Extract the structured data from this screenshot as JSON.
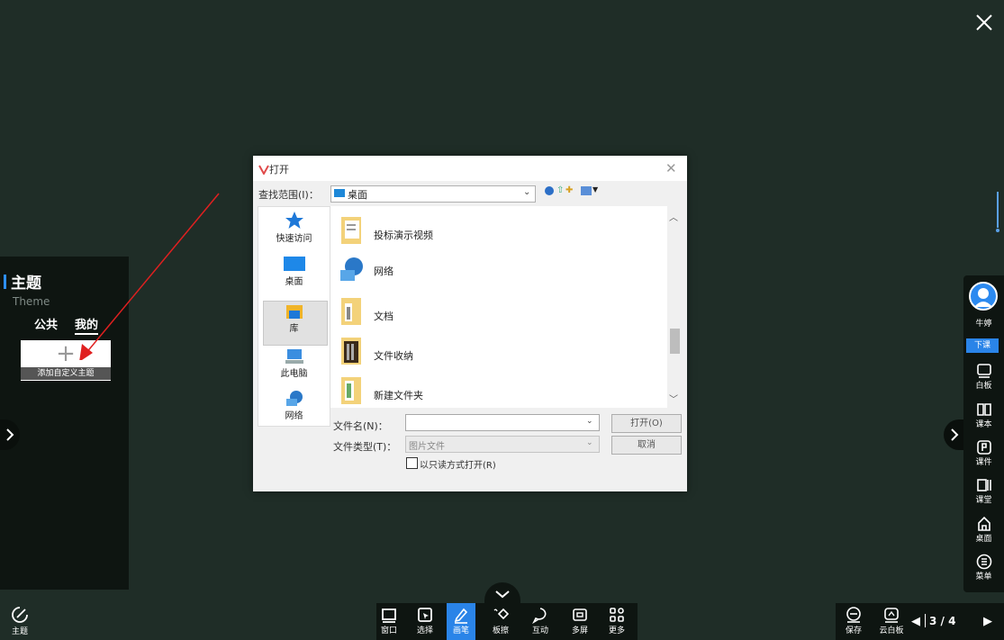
{
  "window": {
    "close_label": "✕"
  },
  "theme_panel": {
    "title": "主题",
    "subtitle": "Theme",
    "tabs": [
      {
        "label": "公共"
      },
      {
        "label": "我的"
      }
    ],
    "add_custom_label": "添加自定义主题",
    "add_plus": "+"
  },
  "dialog": {
    "title": "打开",
    "close": "✕",
    "look_in_label": "查找范围(I)：",
    "look_in_value": "桌面",
    "places": [
      {
        "label": "快速访问",
        "icon": "star-icon"
      },
      {
        "label": "桌面",
        "icon": "desktop-icon"
      },
      {
        "label": "库",
        "icon": "library-icon"
      },
      {
        "label": "此电脑",
        "icon": "computer-icon"
      },
      {
        "label": "网络",
        "icon": "network-icon"
      }
    ],
    "files": [
      {
        "name": "投标演示视频",
        "icon": "folder-icon"
      },
      {
        "name": "网络",
        "icon": "network-icon"
      },
      {
        "name": "文档",
        "icon": "folder-icon"
      },
      {
        "name": "文件收纳",
        "icon": "folder-icon"
      },
      {
        "name": "新建文件夹",
        "icon": "folder-icon"
      }
    ],
    "filename_label": "文件名(N)：",
    "filename_value": "",
    "filetype_label": "文件类型(T)：",
    "filetype_value": "图片文件",
    "readonly_label": "以只读方式打开(R)",
    "open_button": "打开(O)",
    "cancel_button": "取消"
  },
  "right_sidebar": {
    "user_name": "牛婷",
    "end_class": "下课",
    "tools": [
      {
        "label": "白板",
        "icon": "whiteboard-icon"
      },
      {
        "label": "课本",
        "icon": "book-icon"
      },
      {
        "label": "课件",
        "icon": "courseware-icon"
      },
      {
        "label": "课堂",
        "icon": "classroom-icon"
      },
      {
        "label": "桌面",
        "icon": "desktop-home-icon"
      },
      {
        "label": "菜单",
        "icon": "menu-icon"
      }
    ]
  },
  "bottom_bar": {
    "theme_label": "主题",
    "tools": [
      {
        "label": "窗口",
        "icon": "window-icon"
      },
      {
        "label": "选择",
        "icon": "select-icon"
      },
      {
        "label": "画笔",
        "icon": "pen-icon"
      },
      {
        "label": "板擦",
        "icon": "eraser-icon"
      },
      {
        "label": "互动",
        "icon": "interact-icon"
      },
      {
        "label": "多屏",
        "icon": "multiscreen-icon"
      },
      {
        "label": "更多",
        "icon": "more-icon"
      }
    ],
    "save_label": "保存",
    "cloud_label": "云白板",
    "page": "3 / 4"
  },
  "colors": {
    "background": "#1f2d27",
    "panel": "#0e1511",
    "accent": "#2a84e8",
    "arrow": "#e02020"
  }
}
